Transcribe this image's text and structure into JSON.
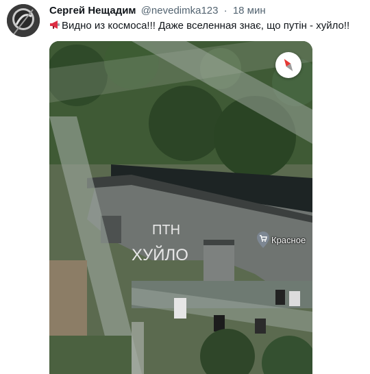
{
  "tweet": {
    "display_name": "Сергей Нещадим",
    "handle": "@nevedimka123",
    "separator": "·",
    "time": "18 мин",
    "text": "Видно из космоса!!! Даже вселенная знає, що путін - хуйло!!",
    "emoji_icon": "megaphone-icon"
  },
  "map": {
    "place_label": "Красное",
    "place_icon": "shopping-cart-icon",
    "compass_icon": "compass-icon",
    "roof_text_line1": "ПТН",
    "roof_text_line2": "ХУЙЛО"
  }
}
